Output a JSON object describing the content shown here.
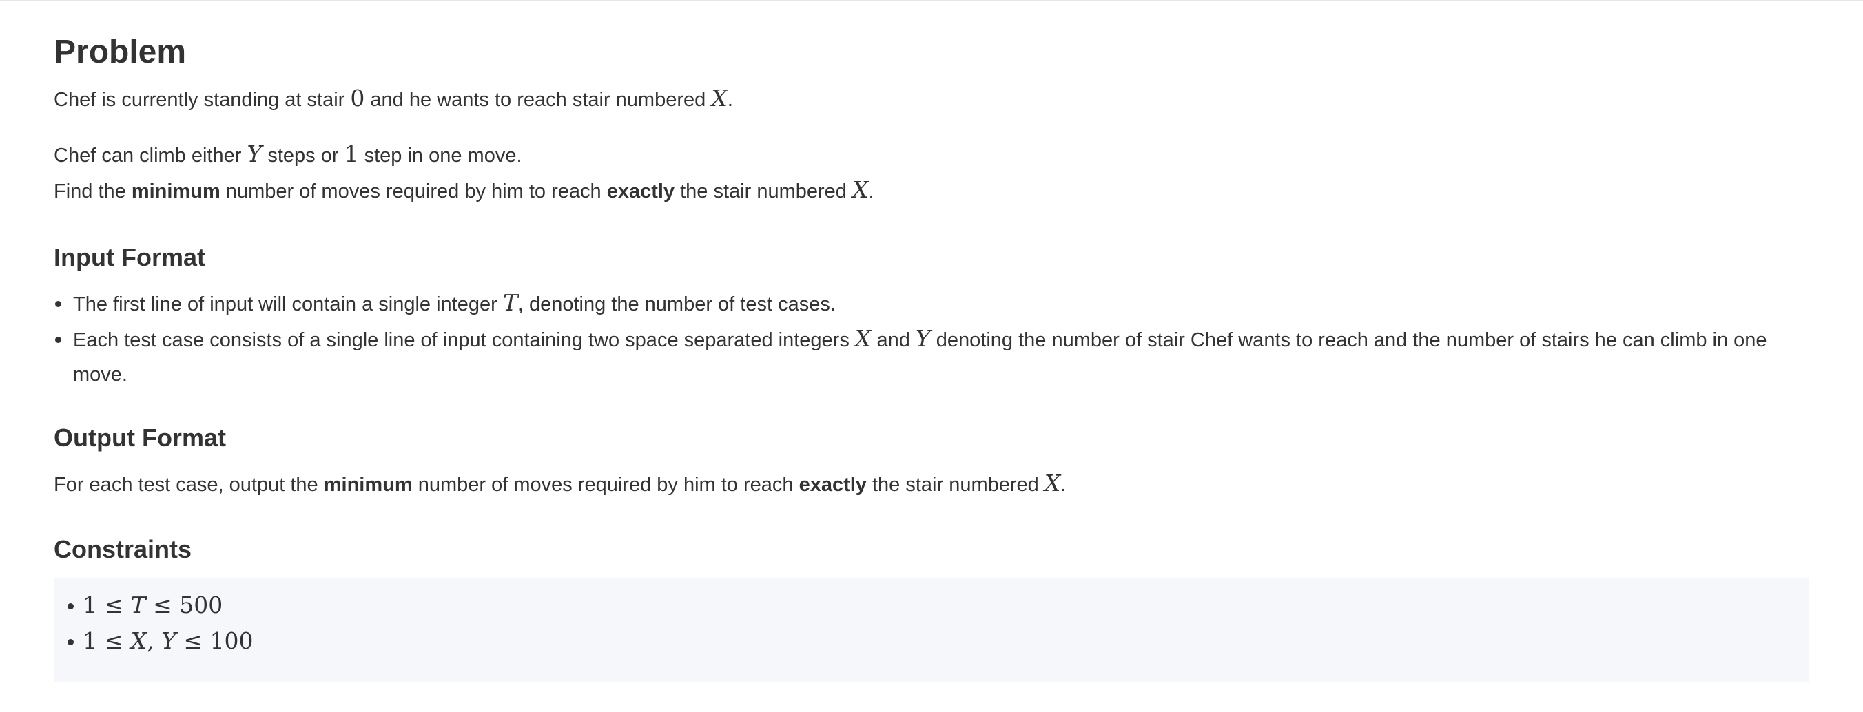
{
  "problem": {
    "title": "Problem",
    "p1": {
      "a": "Chef is currently standing at stair ",
      "zero": "0",
      "b": " and he wants to reach stair numbered ",
      "x": "X",
      "c": "."
    },
    "p2": {
      "a": "Chef can climb either ",
      "y": "Y",
      "b": " steps or ",
      "one": "1",
      "c": " step in one move."
    },
    "p3": {
      "a": "Find the ",
      "bold1": "minimum",
      "b": " number of moves required by him to reach ",
      "bold2": "exactly",
      "c": " the stair numbered ",
      "x": "X",
      "d": "."
    }
  },
  "input_format": {
    "title": "Input Format",
    "item1": {
      "a": "The first line of input will contain a single integer ",
      "t": "T",
      "b": ", denoting the number of test cases."
    },
    "item2": {
      "a": "Each test case consists of a single line of input containing two space separated integers ",
      "x": "X",
      "b": " and ",
      "y": "Y",
      "c": " denoting the number of stair Chef wants to reach and the number of stairs he can climb in one move."
    }
  },
  "output_format": {
    "title": "Output Format",
    "text": {
      "a": "For each test case, output the ",
      "bold1": "minimum",
      "b": " number of moves required by him to reach ",
      "bold2": "exactly",
      "c": " the stair numbered ",
      "x": "X",
      "d": "."
    }
  },
  "constraints": {
    "title": "Constraints",
    "c1": {
      "lo": "1",
      "le1": " ≤ ",
      "var": "T",
      "le2": " ≤ ",
      "hi": "500"
    },
    "c2": {
      "lo": "1",
      "le1": " ≤ ",
      "var1": "X",
      "comma": ", ",
      "var2": "Y",
      "le2": " ≤ ",
      "hi": "100"
    }
  }
}
